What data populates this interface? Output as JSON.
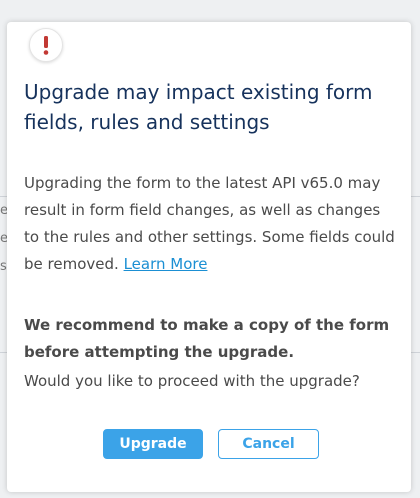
{
  "background": {
    "fragments": [
      "e",
      "e",
      "s"
    ]
  },
  "dialog": {
    "icon": "exclamation-icon",
    "title": "Upgrade may impact existing form fields, rules and settings",
    "paragraph_1": "Upgrading the form to the latest API v65.0 may result in form field changes, as well as changes to the rules and other settings. Some fields could be removed.",
    "learn_more_label": "Learn More",
    "paragraph_2": "We recommend to make a copy of the form before attempting the upgrade.",
    "paragraph_3": "Would you like to proceed with the upgrade?",
    "upgrade_label": "Upgrade",
    "cancel_label": "Cancel"
  },
  "colors": {
    "title": "#16325c",
    "accent": "#3ba3e8",
    "link": "#1b8fd3",
    "warning": "#c23934"
  }
}
